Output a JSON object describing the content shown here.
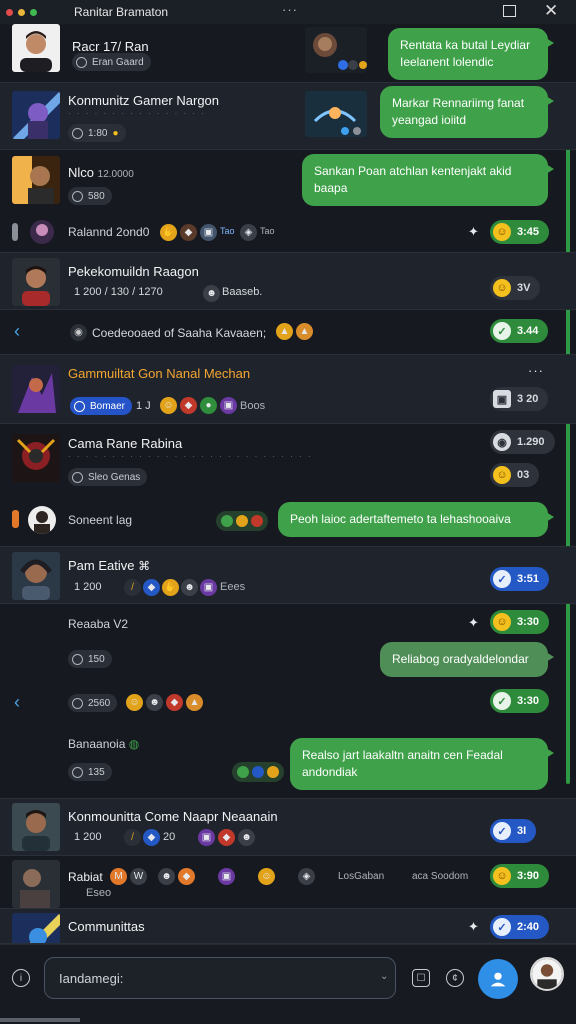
{
  "window": {
    "title": "Ranitar Bramaton",
    "more_label": "···",
    "colors": {
      "red": "#e24b4b",
      "yellow": "#e8b73a",
      "green": "#3fb950"
    }
  },
  "conversations": [
    {
      "name": "Racr 17/ Ran",
      "pill": "Eran Gaard"
    },
    {
      "name": "Konmunitz Gamer Nargon",
      "sub": "",
      "pill": "1:80"
    },
    {
      "name": "Nlco",
      "name_suffix": "12.0000",
      "pill": "580"
    },
    {
      "name": "Ralannd 2ond0",
      "tag": "Tao",
      "tag2": "Tao"
    },
    {
      "name": "Pekekomuildn Raagon",
      "meta": "1 200 / 130 / 1270",
      "meta_tag": "Baaseb.",
      "badge": "3V"
    },
    {
      "system": "Coedeooaed of Saaha Kavaaen;",
      "badge": "3.44"
    },
    {
      "name": "Gammuiltat Gon Nanal Mechan",
      "pill": "Bomaer",
      "pill_extra": "1 J",
      "meta_tag": "Boos",
      "badge": "3 20"
    },
    {
      "name": "Cama Rane Rabina",
      "pill": "Sleo Genas",
      "badge_top": "1.290",
      "badge_bottom": "03"
    },
    {
      "name": "Soneent lag",
      "bubble": "Peoh laioc adertaftemeto ta lehashooaiva"
    },
    {
      "name": "Pam Eative",
      "meta": "1 200",
      "meta_tag": "Eees",
      "badge": "3:51"
    },
    {
      "name": "Reaaba V2",
      "pill": "150",
      "badge": "3:30",
      "bubble": "Reliabog oradyaldelondar"
    },
    {
      "pill": "2560",
      "badge": "3:30"
    },
    {
      "name": "Banaanoia",
      "pill": "135",
      "bubble": "Realso jart laakaltn anaitn cen Feadal andondiak"
    },
    {
      "name": "Konmounitta Come Naapr Neaanain",
      "meta": "1 200",
      "meta_tag": "20",
      "badge": "3I"
    },
    {
      "name": "Rabiat",
      "sub": "Eseo",
      "extra": "LosGaban",
      "extra2": "aca Soodom",
      "badge": "3:90"
    },
    {
      "name": "Communittas",
      "badge": "2:40"
    }
  ],
  "bubbles": {
    "b1": "Rentata ka butal Leydiar Ieelanent lolendic",
    "b2": "Markar Rennariimg fanat yeangad ioiitd",
    "b3": "Sankan Poan atchlan kentenjakt akid baapa"
  },
  "composer": {
    "placeholder": "Iandamegi:",
    "value": "Iandamegi:"
  }
}
